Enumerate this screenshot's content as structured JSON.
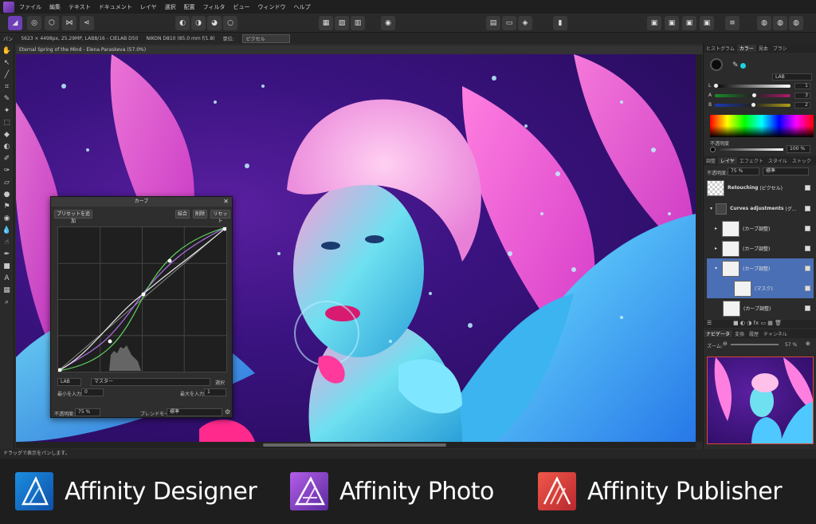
{
  "menu": [
    "ファイル",
    "編集",
    "テキスト",
    "ドキュメント",
    "レイヤ",
    "選択",
    "配置",
    "フィルタ",
    "ビュー",
    "ウィンドウ",
    "ヘルプ"
  ],
  "context_bar": {
    "pan_label": "パン",
    "image_info": "5623 × 4498px, 25.29MP, LAB8/16 - CIELAB D50",
    "camera": "NIKON D810 (85.0 mm f/1.8)",
    "unit_label": "単位:",
    "unit_value": "ピクセル"
  },
  "document_title": "Eternal Spring of the Mind - Elena Paraskeva (57.0%)",
  "status_text": "ドラッグで表示をパンします。",
  "curves_dialog": {
    "title": "カーブ",
    "add_preset": "プリセットを追加",
    "merge": "結合",
    "delete": "削除",
    "reset": "リセット",
    "channel_space": "LAB",
    "channel": "マスター",
    "pick": "選択",
    "min_label": "最小を入力:",
    "min_value": "0",
    "max_label": "最大を入力:",
    "max_value": "1",
    "opacity_label": "不透明度:",
    "opacity_value": "75 %",
    "blend_label": "ブレンドモード:",
    "blend_value": "標準"
  },
  "color_panel": {
    "tabs": [
      "ヒストグラム",
      "カラー",
      "見本",
      "ブラシ"
    ],
    "active_tab": "カラー",
    "model": "LAB",
    "sliders": [
      {
        "label": "L",
        "value": "1",
        "level": 0.02
      },
      {
        "label": "A",
        "value": "3",
        "level": 0.52
      },
      {
        "label": "B",
        "value": "2",
        "level": 0.51
      }
    ],
    "opacity_label": "不透明度",
    "opacity_value": "100 %"
  },
  "layers_panel": {
    "tabs": [
      "調整",
      "レイヤ",
      "エフェクト",
      "スタイル",
      "ストック"
    ],
    "active_tab": "レイヤ",
    "opacity_label": "不透明度:",
    "opacity_value": "75 %",
    "blend_value": "標準",
    "layers": [
      {
        "name": "Retouching",
        "kind": "(ピクセル)"
      },
      {
        "name": "Curves adjustments",
        "kind": "(グ..."
      },
      {
        "name": "",
        "kind": "(カーブ調整)"
      },
      {
        "name": "",
        "kind": "(カーブ調整)"
      },
      {
        "name": "",
        "kind": "(カーブ調整)"
      },
      {
        "name": "",
        "kind": "(マスク)"
      },
      {
        "name": "",
        "kind": "(カーブ調整)"
      }
    ]
  },
  "navigator_panel": {
    "tabs": [
      "ナビゲータ",
      "変換",
      "履歴",
      "チャンネル"
    ],
    "active_tab": "ナビゲータ",
    "zoom_label": "ズーム:",
    "zoom_value": "57 %"
  },
  "products": [
    {
      "name": "Affinity Designer",
      "color_a": "#1b8fe0",
      "color_b": "#0e4fa8"
    },
    {
      "name": "Affinity Photo",
      "color_a": "#b35ee8",
      "color_b": "#5a2a9e"
    },
    {
      "name": "Affinity Publisher",
      "color_a": "#f0584a",
      "color_b": "#b8282e"
    }
  ]
}
